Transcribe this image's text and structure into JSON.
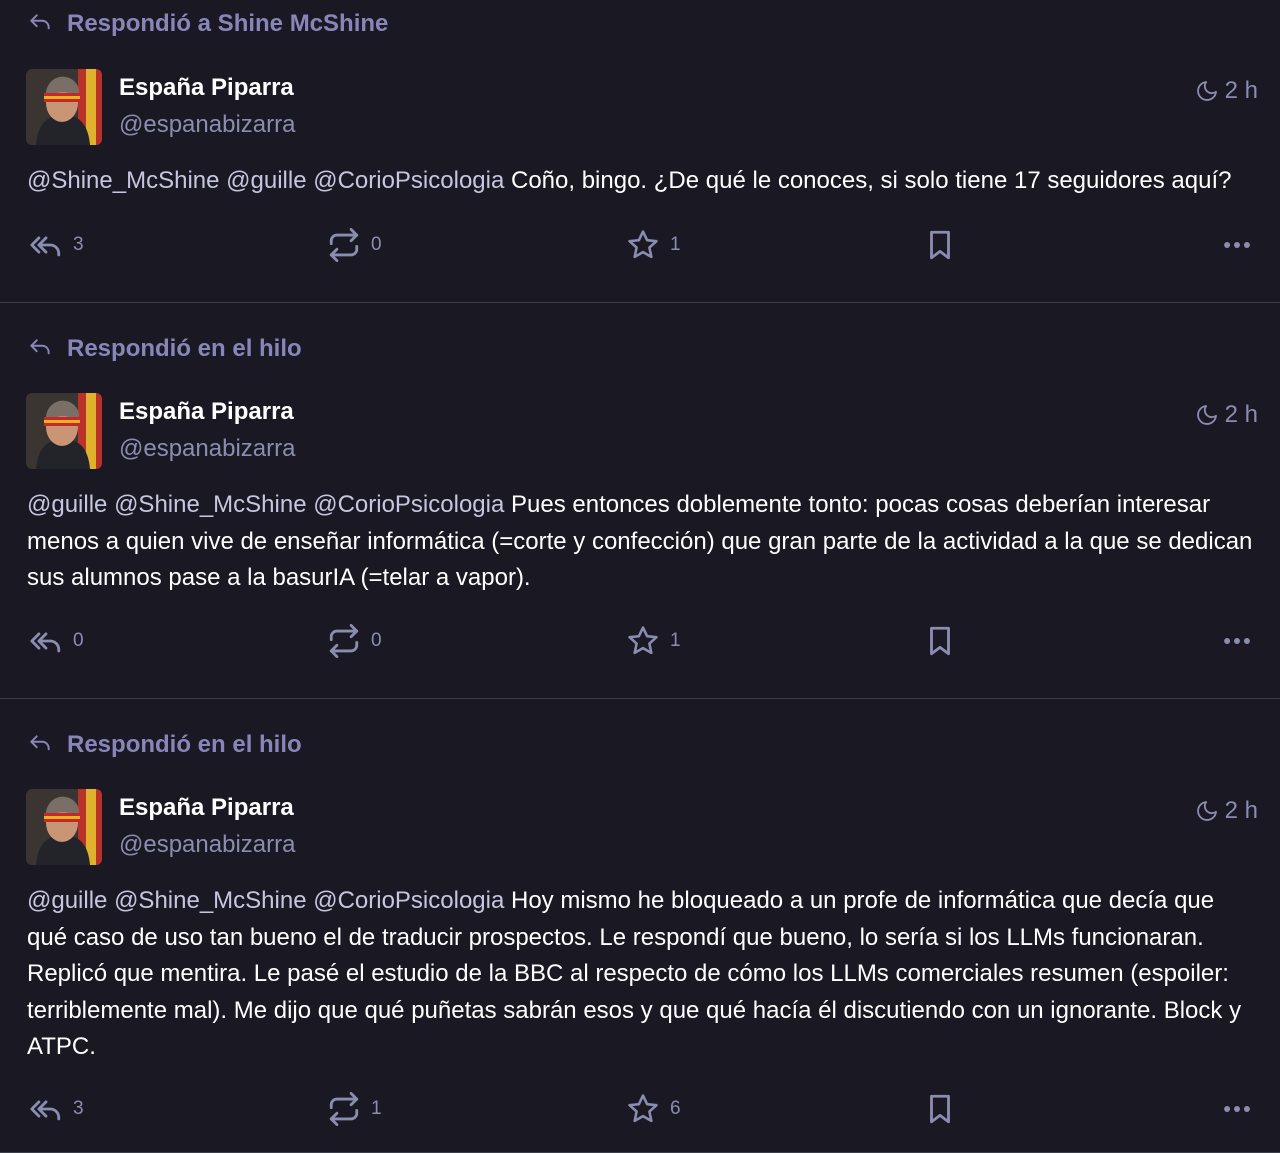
{
  "author": {
    "name": "España Piparra",
    "handle": "@espanabizarra"
  },
  "posts": [
    {
      "context": "Respondió a Shine McShine",
      "time": "2 h",
      "mentions": "@Shine_McShine @guille @CorioPsicologia",
      "text": " Coño, bingo. ¿De qué le conoces, si solo tiene 17 seguidores aquí?",
      "replies": "3",
      "boosts": "0",
      "favs": "1"
    },
    {
      "context": "Respondió en el hilo",
      "time": "2 h",
      "mentions": "@guille @Shine_McShine @CorioPsicologia",
      "text": " Pues entonces doblemente tonto: pocas cosas deberían interesar menos a quien vive de enseñar informática (=corte y confección) que gran parte de la actividad a la que se dedican sus alumnos pase a la basurIA (=telar a vapor).",
      "replies": "0",
      "boosts": "0",
      "favs": "1"
    },
    {
      "context": "Respondió en el hilo",
      "time": "2 h",
      "mentions": "@guille @Shine_McShine @CorioPsicologia",
      "text": " Hoy mismo he bloqueado a un profe de informática que decía que qué caso de uso tan bueno el de traducir prospectos. Le respondí que bueno, lo sería si los LLMs funcionaran. Replicó que mentira. Le pasé el estudio de la BBC al respecto de cómo los LLMs comerciales resumen (espoiler: terriblemente mal). Me dijo que qué puñetas sabrán esos y que qué hacía él discutiendo con un ignorante. Block y ATPC.",
      "replies": "3",
      "boosts": "1",
      "favs": "6"
    }
  ]
}
